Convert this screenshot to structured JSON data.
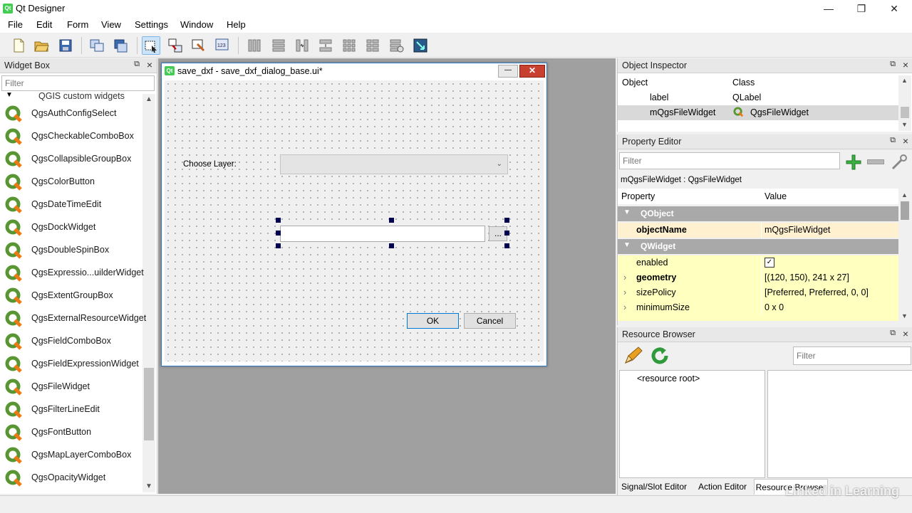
{
  "window": {
    "title": "Qt Designer",
    "logo_text": "Qt"
  },
  "window_controls": {
    "minimize": "—",
    "restore": "❐",
    "close": "✕"
  },
  "menu": [
    "File",
    "Edit",
    "Form",
    "View",
    "Settings",
    "Window",
    "Help"
  ],
  "widget_box": {
    "title": "Widget Box",
    "filter_placeholder": "Filter",
    "category": "QGIS custom widgets",
    "items": [
      "QgsAuthConfigSelect",
      "QgsCheckableComboBox",
      "QgsCollapsibleGroupBox",
      "QgsColorButton",
      "QgsDateTimeEdit",
      "QgsDockWidget",
      "QgsDoubleSpinBox",
      "QgsExpressio...uilderWidget",
      "QgsExtentGroupBox",
      "QgsExternalResourceWidget",
      "QgsFieldComboBox",
      "QgsFieldExpressionWidget",
      "QgsFileWidget",
      "QgsFilterLineEdit",
      "QgsFontButton",
      "QgsMapLayerComboBox",
      "QgsOpacityWidget"
    ]
  },
  "form": {
    "title": "save_dxf - save_dxf_dialog_base.ui*",
    "logo_text": "Qt",
    "choose_layer_label": "Choose Layer:",
    "browse_button": "...",
    "ok_button": "OK",
    "cancel_button": "Cancel"
  },
  "object_inspector": {
    "title": "Object Inspector",
    "columns": [
      "Object",
      "Class"
    ],
    "rows": [
      {
        "object": "label",
        "class": "QLabel"
      },
      {
        "object": "mQgsFileWidget",
        "class": "QgsFileWidget"
      }
    ]
  },
  "property_editor": {
    "title": "Property Editor",
    "filter_placeholder": "Filter",
    "context": "mQgsFileWidget : QgsFileWidget",
    "columns": [
      "Property",
      "Value"
    ],
    "rows": [
      {
        "type": "group",
        "name": "QObject"
      },
      {
        "type": "prop",
        "name": "objectName",
        "value": "mQgsFileWidget",
        "bold": true,
        "style": "peach"
      },
      {
        "type": "group",
        "name": "QWidget"
      },
      {
        "type": "prop",
        "name": "enabled",
        "value": "✓",
        "style": "yellow"
      },
      {
        "type": "prop",
        "name": "geometry",
        "value": "[(120, 150), 241 x 27]",
        "bold": true,
        "expand": true,
        "style": "yellow"
      },
      {
        "type": "prop",
        "name": "sizePolicy",
        "value": "[Preferred, Preferred, 0, 0]",
        "expand": true,
        "style": "yellow"
      },
      {
        "type": "prop",
        "name": "minimumSize",
        "value": "0 x 0",
        "expand": true,
        "style": "yellow"
      }
    ]
  },
  "resource_browser": {
    "title": "Resource Browser",
    "filter_placeholder": "Filter",
    "root": "<resource root>"
  },
  "bottom_tabs": [
    "Signal/Slot Editor",
    "Action Editor",
    "Resource Browser"
  ],
  "watermark": "Linked in Learning"
}
